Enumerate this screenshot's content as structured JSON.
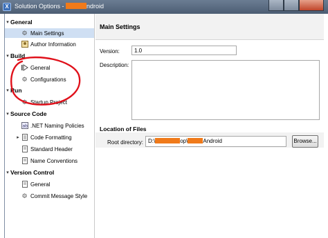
{
  "window": {
    "title_prefix": "Solution Options - ",
    "title_suffix": "ndroid"
  },
  "sidebar": {
    "categories": [
      {
        "label": "General",
        "items": [
          "Main Settings",
          "Author Information"
        ]
      },
      {
        "label": "Build",
        "items": [
          "General",
          "Configurations"
        ]
      },
      {
        "label": "Run",
        "items": [
          "Startup Project"
        ]
      },
      {
        "label": "Source Code",
        "items": [
          ".NET Naming Policies",
          "Code Formatting",
          "Standard Header",
          "Name Conventions"
        ]
      },
      {
        "label": "Version Control",
        "items": [
          "General",
          "Commit Message Style"
        ]
      }
    ],
    "selected": "Main Settings"
  },
  "main": {
    "heading": "Main Settings",
    "version_label": "Version:",
    "version_value": "1.0",
    "description_label": "Description:",
    "description_value": "",
    "location_heading": "Location of Files",
    "root_label": "Root directory:",
    "root_value_prefix": "D:\\",
    "root_value_mid": "op\\",
    "root_value_suffix": "Android",
    "browse_label": "Browse..."
  },
  "colors": {
    "selection": "#cfdff3",
    "annotation": "#e0101a",
    "redaction": "#f07a1a"
  }
}
